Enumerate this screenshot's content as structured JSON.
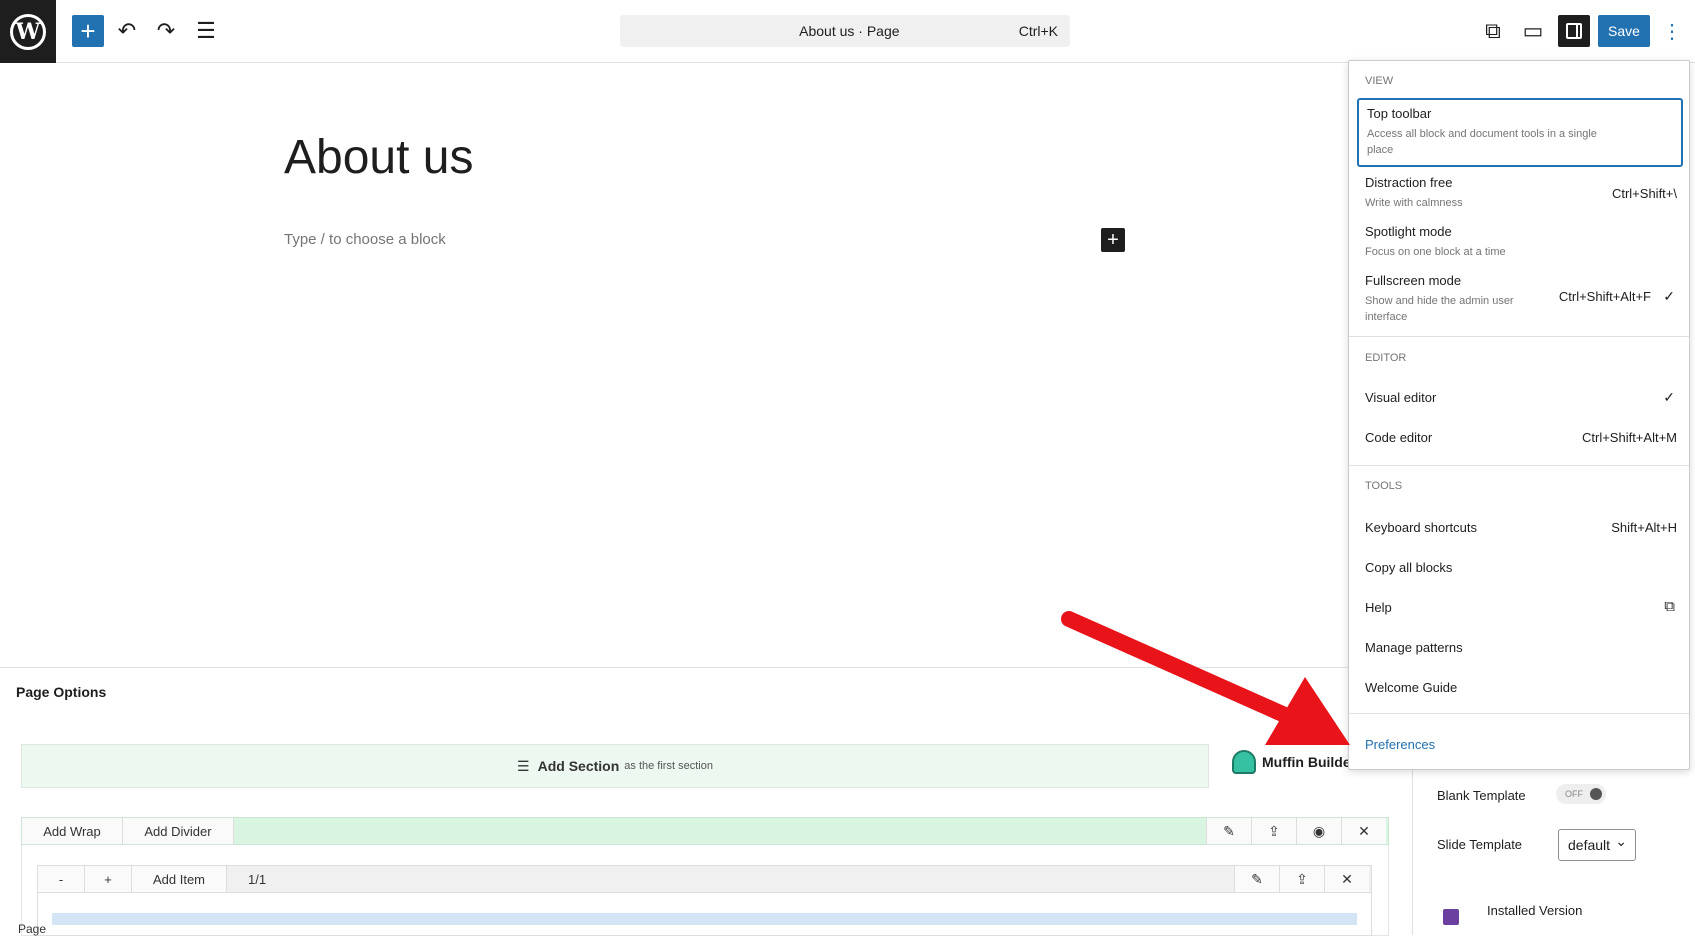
{
  "header": {
    "document_title": "About us · Page",
    "command_shortcut": "Ctrl+K",
    "save_label": "Save"
  },
  "editor": {
    "page_title": "About us",
    "block_placeholder": "Type / to choose a block"
  },
  "meta": {
    "title": "Page Options",
    "add_section_label": "Add Section",
    "add_section_hint": "as the first section",
    "builder_name": "Muffin Builder",
    "wrap_buttons": [
      "Add Wrap",
      "Add Divider"
    ],
    "item_buttons": [
      "-",
      "+",
      "Add Item"
    ],
    "item_ratio": "1/1",
    "footer_label": "Page",
    "blank_template_label": "Blank Template",
    "blank_template_toggle": "OFF",
    "slide_template_label": "Slide Template",
    "slide_template_value": "default",
    "installed_version_label": "Installed Version"
  },
  "menu": {
    "view_label": "VIEW",
    "view_items": [
      {
        "label": "Top toolbar",
        "desc": "Access all block and document tools in a single place",
        "shortcut": ""
      },
      {
        "label": "Distraction free",
        "desc": "Write with calmness",
        "shortcut": "Ctrl+Shift+\\"
      },
      {
        "label": "Spotlight mode",
        "desc": "Focus on one block at a time",
        "shortcut": ""
      },
      {
        "label": "Fullscreen mode",
        "desc": "Show and hide the admin user interface",
        "shortcut": "Ctrl+Shift+Alt+F"
      }
    ],
    "editor_label": "EDITOR",
    "editor_items": [
      {
        "label": "Visual editor",
        "shortcut": ""
      },
      {
        "label": "Code editor",
        "shortcut": "Ctrl+Shift+Alt+M"
      }
    ],
    "tools_label": "TOOLS",
    "tools_items": [
      {
        "label": "Keyboard shortcuts",
        "shortcut": "Shift+Alt+H"
      },
      {
        "label": "Copy all blocks",
        "shortcut": ""
      },
      {
        "label": "Help",
        "shortcut": ""
      },
      {
        "label": "Manage patterns",
        "shortcut": ""
      },
      {
        "label": "Welcome Guide",
        "shortcut": ""
      }
    ],
    "preferences_label": "Preferences"
  },
  "colors": {
    "accent": "#2271b1",
    "arrow": "#e8141a"
  }
}
